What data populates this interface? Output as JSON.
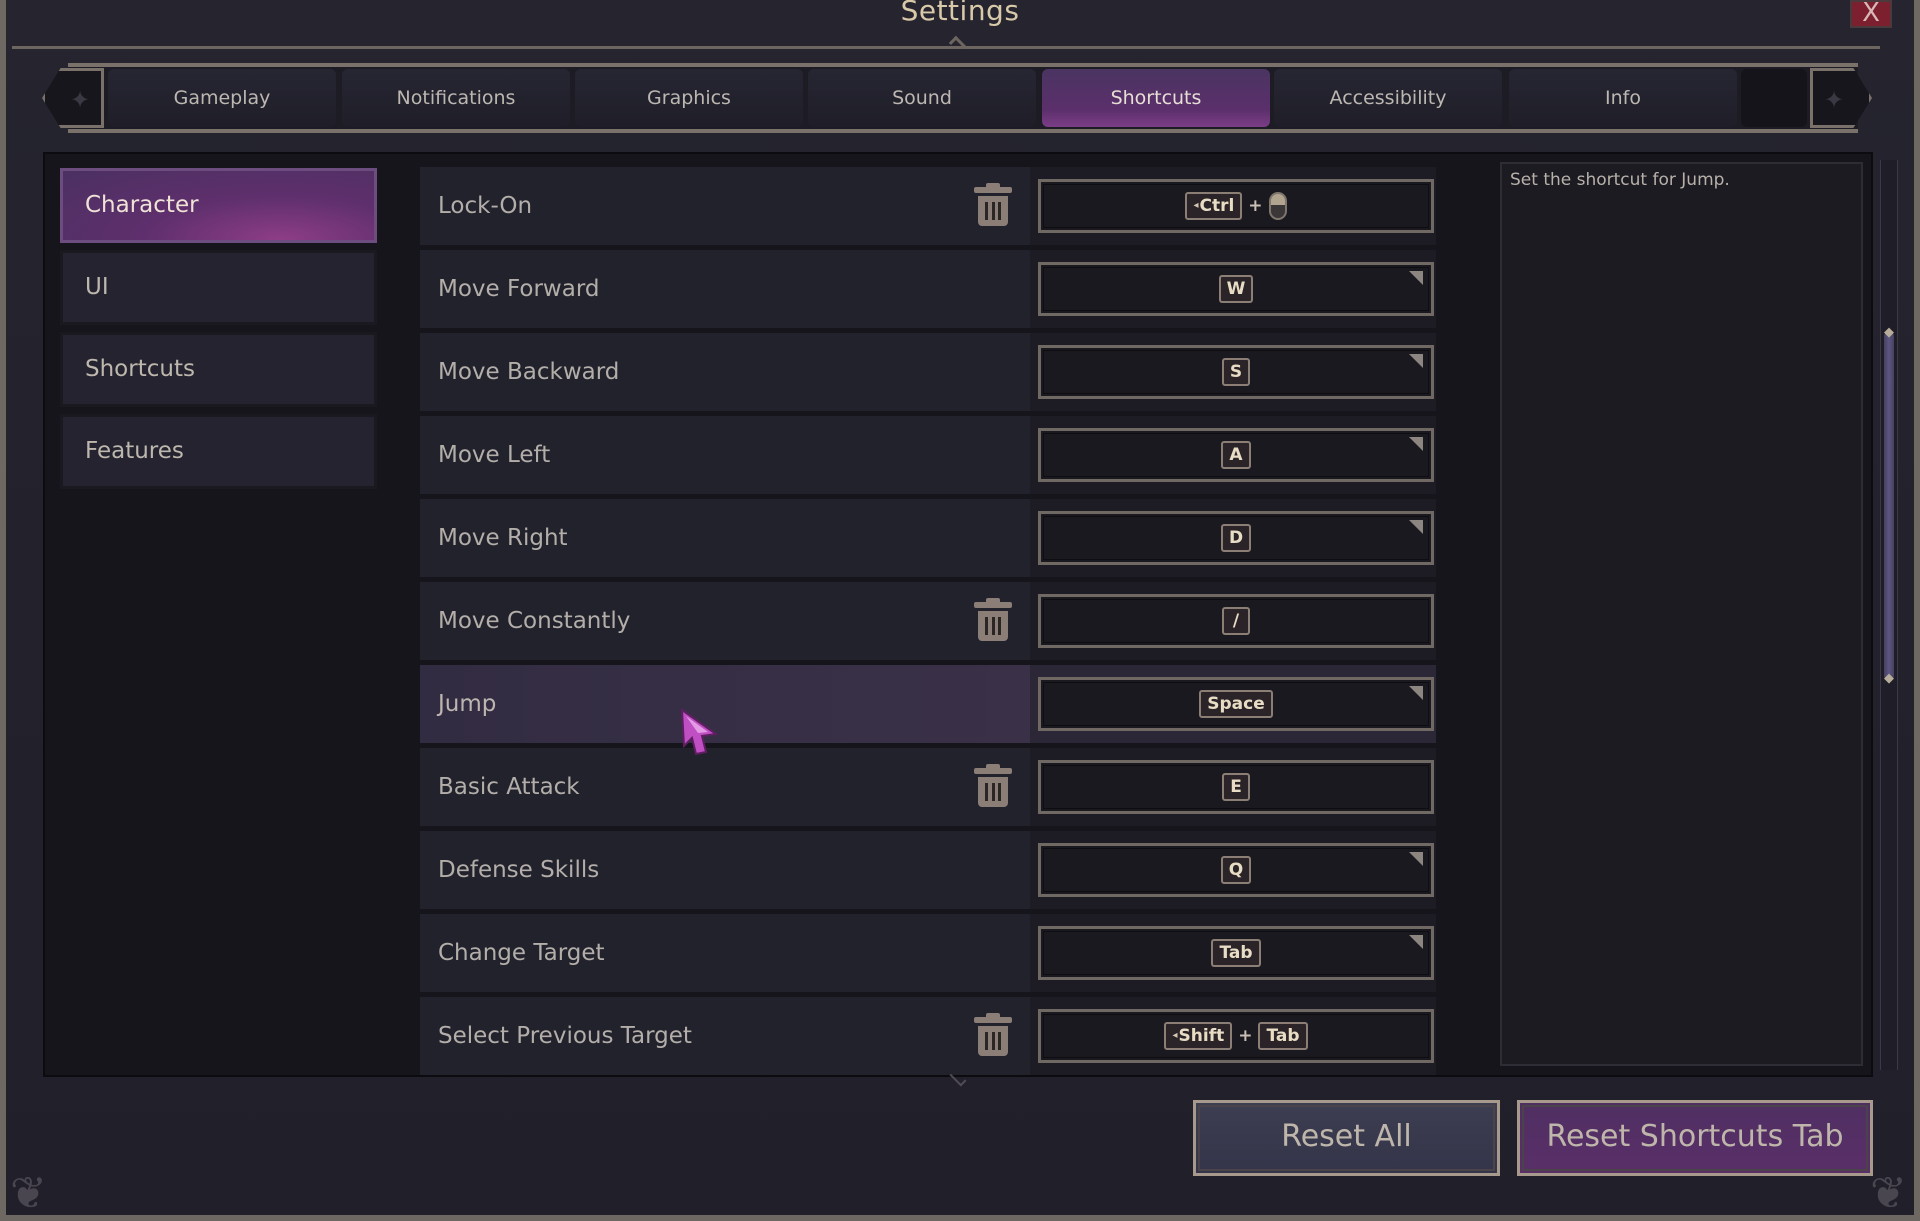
{
  "window": {
    "title": "Settings",
    "close_label": "X"
  },
  "tabs": [
    {
      "label": "Gameplay",
      "active": false
    },
    {
      "label": "Notifications",
      "active": false
    },
    {
      "label": "Graphics",
      "active": false
    },
    {
      "label": "Sound",
      "active": false
    },
    {
      "label": "Shortcuts",
      "active": true
    },
    {
      "label": "Accessibility",
      "active": false
    },
    {
      "label": "Info",
      "active": false
    }
  ],
  "sidebar": {
    "items": [
      {
        "label": "Character",
        "active": true
      },
      {
        "label": "UI",
        "active": false
      },
      {
        "label": "Shortcuts",
        "active": false
      },
      {
        "label": "Features",
        "active": false
      }
    ]
  },
  "shortcuts": [
    {
      "action": "Lock-On",
      "keys": [
        "Ctrl",
        "mouse-left-click"
      ],
      "modifier": "Ctrl",
      "deletable": true,
      "dropdown": false
    },
    {
      "action": "Move Forward",
      "keys": [
        "W"
      ],
      "deletable": false,
      "dropdown": true
    },
    {
      "action": "Move Backward",
      "keys": [
        "S"
      ],
      "deletable": false,
      "dropdown": true
    },
    {
      "action": "Move Left",
      "keys": [
        "A"
      ],
      "deletable": false,
      "dropdown": true
    },
    {
      "action": "Move Right",
      "keys": [
        "D"
      ],
      "deletable": false,
      "dropdown": true
    },
    {
      "action": "Move Constantly",
      "keys": [
        "/"
      ],
      "deletable": true,
      "dropdown": false
    },
    {
      "action": "Jump",
      "keys": [
        "Space"
      ],
      "deletable": false,
      "dropdown": true,
      "highlighted": true
    },
    {
      "action": "Basic Attack",
      "keys": [
        "E"
      ],
      "deletable": true,
      "dropdown": false
    },
    {
      "action": "Defense Skills",
      "keys": [
        "Q"
      ],
      "deletable": false,
      "dropdown": true
    },
    {
      "action": "Change Target",
      "keys": [
        "Tab"
      ],
      "deletable": false,
      "dropdown": true
    },
    {
      "action": "Select Previous Target",
      "keys": [
        "Shift",
        "Tab"
      ],
      "modifier": "Shift",
      "deletable": true,
      "dropdown": false
    }
  ],
  "description": {
    "text": "Set the shortcut for Jump."
  },
  "scrollbar": {
    "thumb_start_fraction": 0.19,
    "thumb_size_fraction": 0.38
  },
  "buttons": {
    "reset_all": "Reset All",
    "reset_tab": "Reset Shortcuts Tab"
  },
  "colors": {
    "accent_purple": "#5b2f6b",
    "background": "#23222d",
    "close_red": "#7c1f2e",
    "text_gold": "#d8c9a8"
  }
}
